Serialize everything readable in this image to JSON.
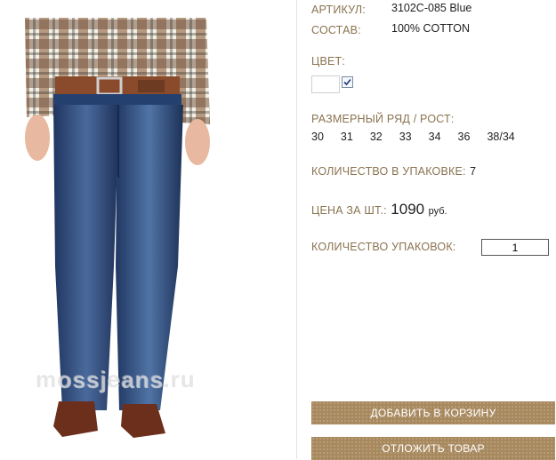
{
  "product": {
    "sku_label": "АРТИКУЛ:",
    "sku_value": "3102C-085 Blue",
    "composition_label": "СОСТАВ:",
    "composition_value": "100% COTTON",
    "color_label": "ЦВЕТ:",
    "color_swatch": "#ffffff",
    "color_selected": true,
    "sizes_label": "РАЗМЕРНЫЙ РЯД / РОСТ:",
    "sizes": [
      "30",
      "31",
      "32",
      "33",
      "34",
      "36",
      "38/34"
    ],
    "pack_qty_label": "КОЛИЧЕСТВО В УПАКОВКЕ:",
    "pack_qty_value": "7",
    "price_label": "ЦЕНА ЗА ШТ.:",
    "price_value": "1090",
    "price_unit": "руб.",
    "packs_label": "КОЛИЧЕСТВО УПАКОВОК:",
    "packs_value": "1"
  },
  "photo": {
    "watermark": "mossjeans.ru",
    "subject": "jeans-model-photo"
  },
  "actions": {
    "add_to_cart": "ДОБАВИТЬ В КОРЗИНУ",
    "defer": "ОТЛОЖИТЬ ТОВАР"
  },
  "colors": {
    "label": "#8a7350",
    "button": "#a8895e",
    "denim": "#2e4a7a"
  }
}
